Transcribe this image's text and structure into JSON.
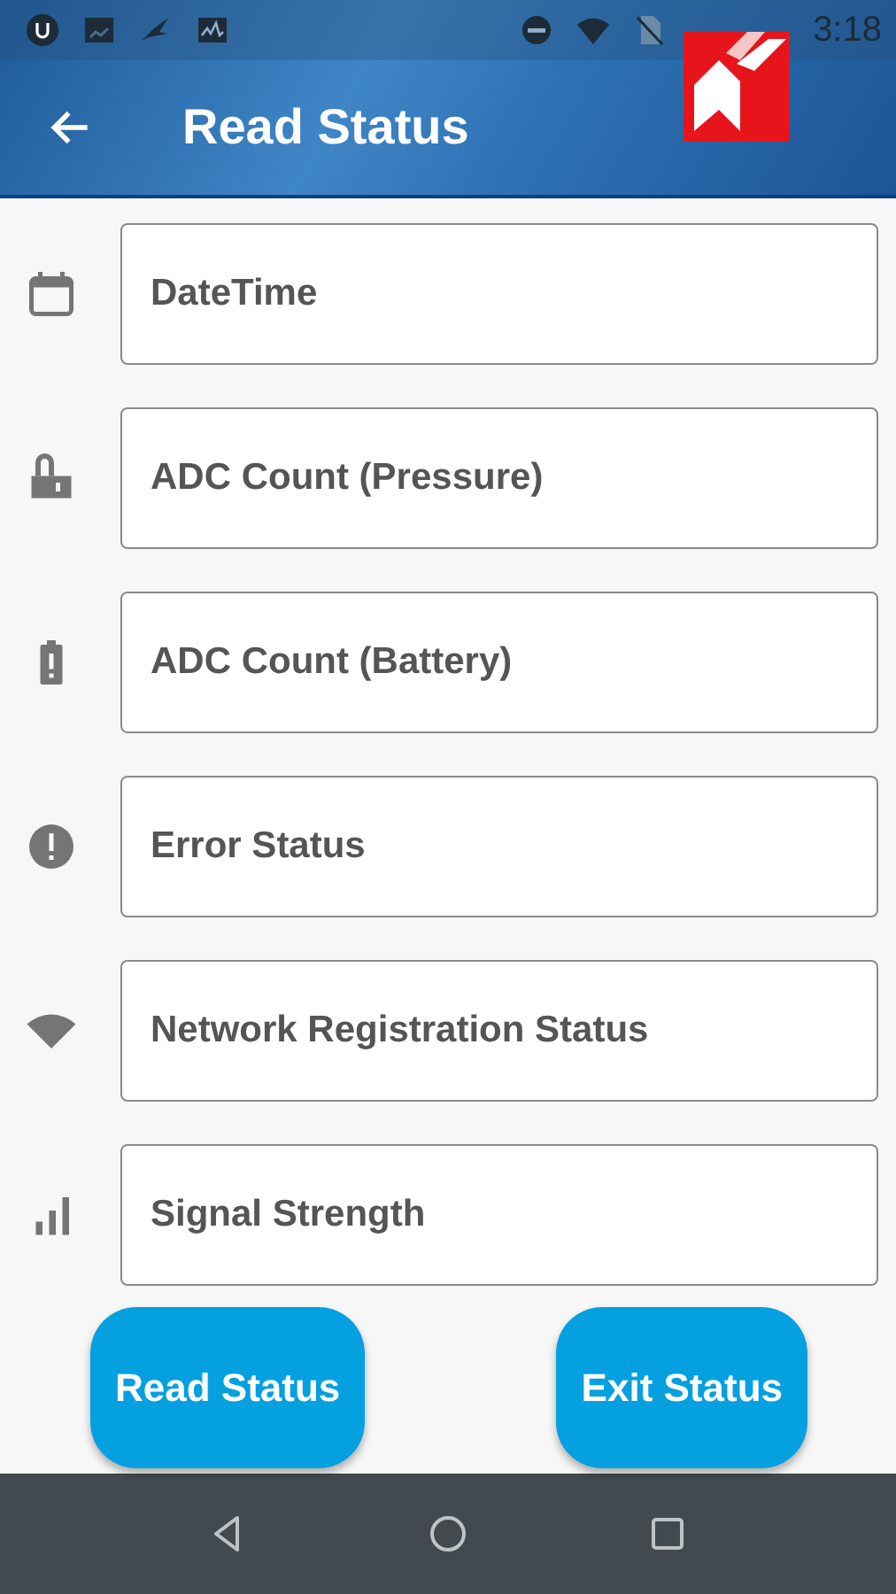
{
  "status_bar": {
    "time": "3:18"
  },
  "app_bar": {
    "title": "Read Status"
  },
  "fields": [
    {
      "kind": "calendar",
      "placeholder": "DateTime"
    },
    {
      "kind": "lock",
      "placeholder": "ADC Count (Pressure)"
    },
    {
      "kind": "battery",
      "placeholder": "ADC Count (Battery)"
    },
    {
      "kind": "error",
      "placeholder": "Error Status"
    },
    {
      "kind": "wifi",
      "placeholder": "Network Registration Status"
    },
    {
      "kind": "signal",
      "placeholder": "Signal Strength"
    }
  ],
  "buttons": [
    {
      "label": "Read Status"
    },
    {
      "label": "Exit Status"
    }
  ]
}
